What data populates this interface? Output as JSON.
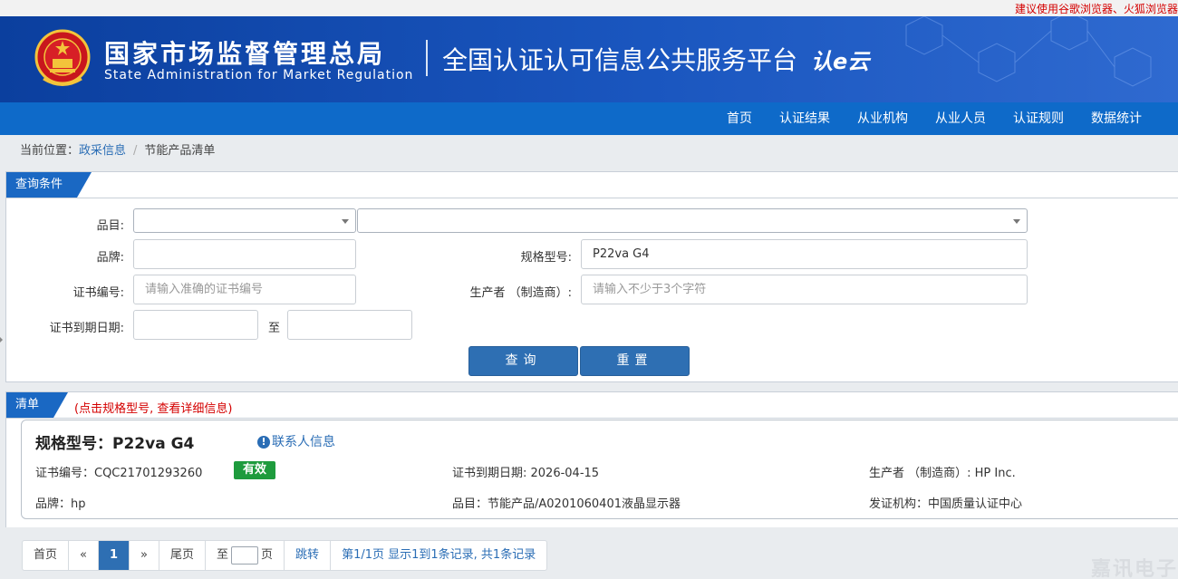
{
  "topbar": {
    "notice": "建议使用谷歌浏览器、火狐浏览器"
  },
  "header": {
    "org_cn": "国家市场监督管理总局",
    "org_en": "State Administration  for  Market Regulation",
    "platform": "全国认证认可信息公共服务平台",
    "logo_text": "认e云"
  },
  "nav": {
    "items": [
      "首页",
      "认证结果",
      "从业机构",
      "从业人员",
      "认证规则",
      "数据统计"
    ]
  },
  "breadcrumb": {
    "prefix": "当前位置：",
    "link": "政采信息",
    "sep": "/",
    "current": "节能产品清单"
  },
  "query": {
    "tab": "查询条件",
    "category_label": "品目:",
    "brand_label": "品牌:",
    "model_label": "规格型号:",
    "model_value": "P22va G4",
    "cert_label": "证书编号:",
    "cert_placeholder": "请输入准确的证书编号",
    "maker_label": "生产者 （制造商）:",
    "maker_placeholder": "请输入不少于3个字符",
    "expire_label": "证书到期日期:",
    "to_label": "至",
    "search_btn": "查询",
    "reset_btn": "重置"
  },
  "list": {
    "tab": "清单",
    "hint": "(点击规格型号, 查看详细信息)",
    "result": {
      "title": "规格型号：P22va G4",
      "contact": "联系人信息",
      "cert": "证书编号：CQC21701293260",
      "status": "有效",
      "expire": "证书到期日期: 2026-04-15",
      "maker": "生产者 （制造商）: HP Inc.",
      "brand": "品牌：hp",
      "category": "品目：节能产品/A0201060401液晶显示器",
      "issuer": "发证机构：中国质量认证中心"
    }
  },
  "pager": {
    "first": "首页",
    "prev": "«",
    "page": "1",
    "next": "»",
    "last": "尾页",
    "goto_prefix": "至",
    "goto_suffix": "页",
    "jump": "跳转",
    "summary": "第1/1页  显示1到1条记录, 共1条记录"
  },
  "watermark": "嘉讯电子"
}
